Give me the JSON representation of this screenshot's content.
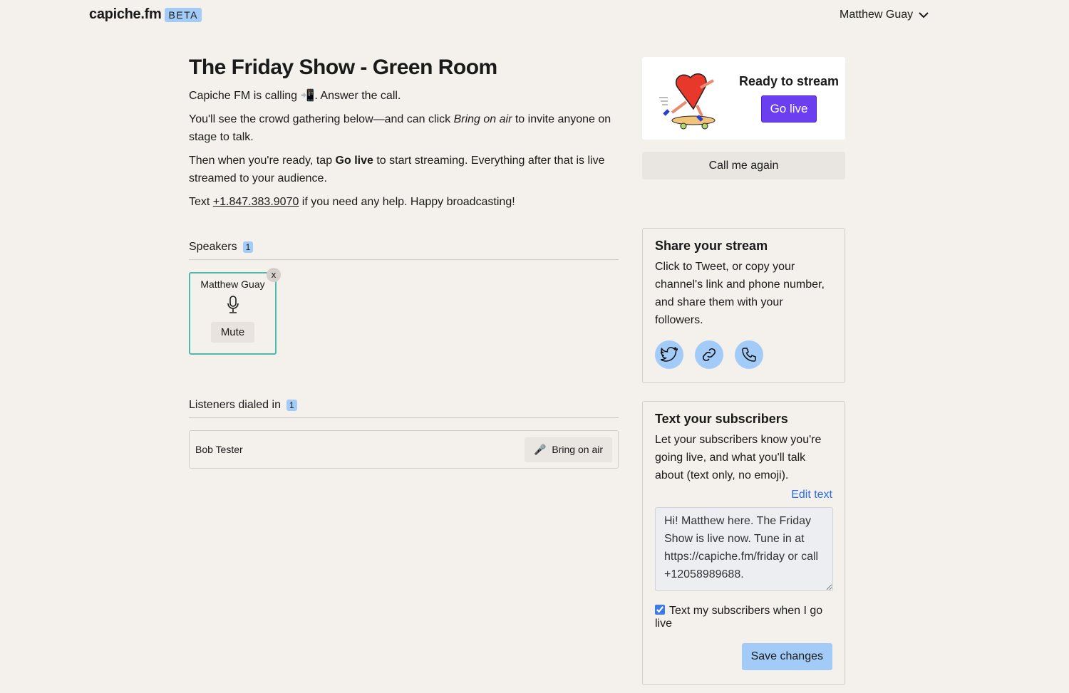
{
  "header": {
    "logo": "capiche.fm",
    "badge": "BETA",
    "user": "Matthew Guay"
  },
  "main": {
    "title": "The Friday Show - Green Room",
    "calling_pre": "Capiche FM is calling ",
    "calling_emoji": "📲",
    "calling_post": ". Answer the call.",
    "p2_pre": "You'll see the crowd gathering below—and can click ",
    "p2_em": "Bring on air",
    "p2_post": " to invite anyone on stage to talk.",
    "p3_pre": "Then when you're ready, tap ",
    "p3_b": "Go live",
    "p3_post": " to start streaming. Everything after that is live streamed to your audience.",
    "p4_pre": "Text ",
    "p4_link": "+1.847.383.9070",
    "p4_post": " if you need any help. Happy broadcasting!"
  },
  "speakers": {
    "label": "Speakers",
    "count": "1",
    "items": [
      {
        "name": "Matthew Guay",
        "mute_label": "Mute",
        "remove": "x"
      }
    ]
  },
  "listeners": {
    "label": "Listeners dialed in",
    "count": "1",
    "items": [
      {
        "name": "Bob Tester",
        "action": "Bring on air",
        "icon": "🎤"
      }
    ]
  },
  "stream": {
    "ready": "Ready to stream",
    "go_live": "Go live",
    "call_again": "Call me again"
  },
  "share": {
    "title": "Share your stream",
    "text": "Click to Tweet, or copy your channel's link and phone number, and share them with your followers.",
    "icons": [
      "twitter-icon",
      "link-icon",
      "phone-icon"
    ]
  },
  "subscribers": {
    "title": "Text your subscribers",
    "text": "Let your subscribers know you're going live, and what you'll talk about (text only, no emoji).",
    "edit": "Edit text",
    "message": "Hi! Matthew here. The Friday Show is live now. Tune in at https://capiche.fm/friday or call +12058989688.",
    "checkbox_label": "Text my subscribers when I go live",
    "checked": true,
    "save": "Save changes"
  },
  "colors": {
    "accent": "#6b3ef0",
    "badge": "#a3cbf7",
    "speaker_border": "#4fb8ad",
    "link": "#2a6cf0"
  }
}
